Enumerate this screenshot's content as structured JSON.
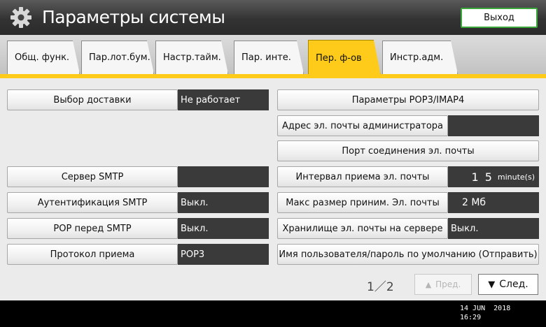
{
  "header": {
    "title": "Параметры системы",
    "exit_label": "Выход"
  },
  "tabs": [
    {
      "label": "Общ. функ.",
      "active": false
    },
    {
      "label": "Пар.лот.бум.",
      "active": false
    },
    {
      "label": "Настр.тайм.",
      "active": false
    },
    {
      "label": "Пар. инте.",
      "active": false
    },
    {
      "label": "Пер. ф-ов",
      "active": true
    },
    {
      "label": "Инстр.адм.",
      "active": false
    }
  ],
  "left_settings": [
    {
      "label": "Выбор доставки",
      "value": "Не работает"
    },
    {
      "label": "Сервер SMTP",
      "value": ""
    },
    {
      "label": "Аутентификация SMTP",
      "value": "Выкл."
    },
    {
      "label": "POP перед SMTP",
      "value": "Выкл."
    },
    {
      "label": "Протокол приема",
      "value": "POP3"
    }
  ],
  "right_settings": [
    {
      "label": "Параметры POP3/IMAP4"
    },
    {
      "label": "Адрес эл. почты администратора",
      "value": ""
    },
    {
      "label": "Порт соединения эл. почты"
    },
    {
      "label": "Интервал приема эл. почты",
      "value_num": "1 5",
      "value_unit": "minute(s)"
    },
    {
      "label": "Макс размер приним. Эл. почты",
      "value": "2 Мб"
    },
    {
      "label": "Хранилище эл. почты на сервере",
      "value": "Выкл."
    },
    {
      "label": "Имя пользователя/пароль по умолчанию (Отправить)"
    }
  ],
  "pager": {
    "text": "1／2",
    "prev_label": "Пред.",
    "next_label": "След."
  },
  "clock": {
    "date": "14 JUN  2018",
    "time": "16:29"
  },
  "colors": {
    "accent": "#ffcb1a",
    "exit_border": "#3aa83a",
    "value_bg": "#3a3a3a"
  }
}
